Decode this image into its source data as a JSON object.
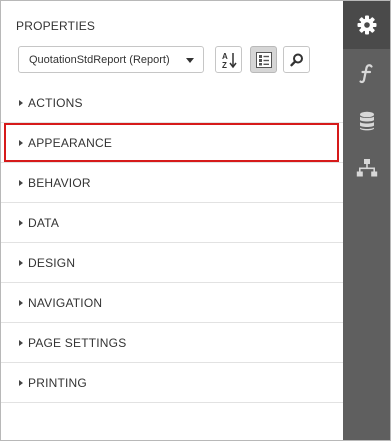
{
  "panel": {
    "title": "PROPERTIES",
    "selector_value": "QuotationStdReport (Report)"
  },
  "toolbar": [
    {
      "icon": "sort-az-icon",
      "active": false
    },
    {
      "icon": "categorized-icon",
      "active": true
    },
    {
      "icon": "search-icon",
      "active": false
    }
  ],
  "categories": [
    {
      "label": "ACTIONS",
      "selected": false
    },
    {
      "label": "APPEARANCE",
      "selected": true
    },
    {
      "label": "BEHAVIOR",
      "selected": false
    },
    {
      "label": "DATA",
      "selected": false
    },
    {
      "label": "DESIGN",
      "selected": false
    },
    {
      "label": "NAVIGATION",
      "selected": false
    },
    {
      "label": "PAGE SETTINGS",
      "selected": false
    },
    {
      "label": "PRINTING",
      "selected": false
    }
  ],
  "sidebar_tabs": [
    {
      "icon": "gear-icon",
      "active": true
    },
    {
      "icon": "function-icon",
      "active": false
    },
    {
      "icon": "database-icon",
      "active": false
    },
    {
      "icon": "tree-icon",
      "active": false
    }
  ],
  "colors": {
    "sidebar": "#5f5f5f",
    "sidebar_active": "#4a4a4a",
    "highlight": "#d61a1a"
  }
}
